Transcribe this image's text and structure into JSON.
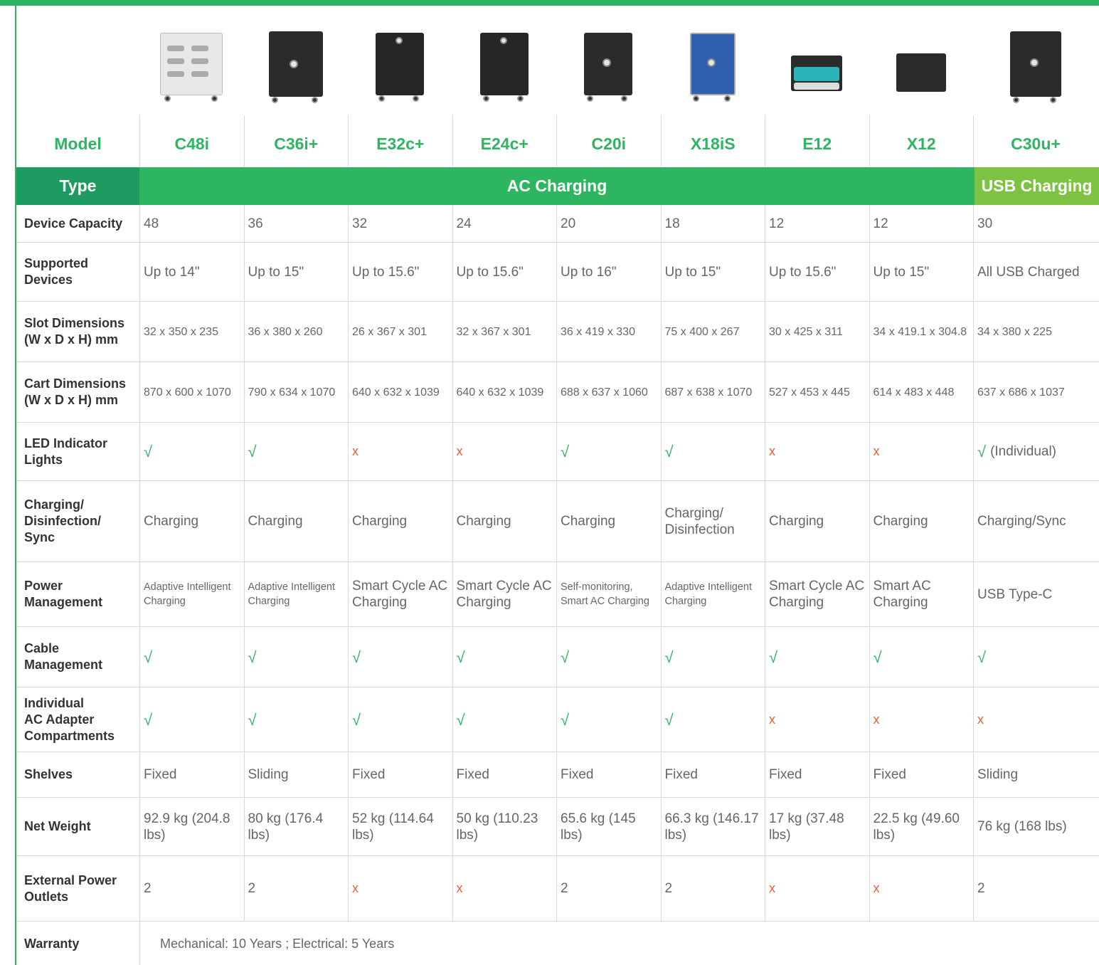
{
  "model_label": "Model",
  "type_label": "Type",
  "type_ac": "AC Charging",
  "type_usb": "USB Charging",
  "models": [
    "C48i",
    "C36i+",
    "E32c+",
    "E24c+",
    "C20i",
    "X18iS",
    "E12",
    "X12",
    "C30u+"
  ],
  "rows": [
    {
      "label": [
        "Device Capacity"
      ],
      "size": "",
      "values": [
        "48",
        "36",
        "32",
        "24",
        "20",
        "18",
        "12",
        "12",
        "30"
      ],
      "height": 53
    },
    {
      "label": [
        "Supported",
        "Devices"
      ],
      "size": "",
      "values": [
        "Up to 14\"",
        "Up to 15\"",
        "Up to 15.6\"",
        "Up to 15.6\"",
        "Up to 16\"",
        "Up to 15\"",
        "Up to 15.6\"",
        "Up to 15\"",
        "All USB Charged"
      ],
      "height": 83
    },
    {
      "label": [
        "Slot Dimensions",
        "(W x D x H) mm"
      ],
      "size": "sm",
      "values": [
        "32 x 350 x 235",
        "36 x 380 x 260",
        "26 x 367 x 301",
        "32 x 367 x 301",
        "36 x 419 x 330",
        "75 x 400 x 267",
        "30 x 425 x 311",
        "34 x 419.1 x 304.8",
        "34 x 380 x 225"
      ],
      "height": 85
    },
    {
      "label": [
        "Cart Dimensions",
        "(W x D x H) mm"
      ],
      "size": "sm",
      "values": [
        "870 x 600 x 1070",
        "790 x 634 x 1070",
        "640 x 632 x 1039",
        "640 x 632 x 1039",
        "688 x 637 x 1060",
        "687 x 638 x 1070",
        "527 x 453 x 445",
        "614 x 483 x 448",
        "637 x 686 x 1037"
      ],
      "height": 85
    },
    {
      "label": [
        "LED Indicator",
        "Lights"
      ],
      "size": "",
      "values": [
        "√",
        "√",
        "x",
        "x",
        "√",
        "√",
        "x",
        "x",
        "√"
      ],
      "extra_last": "(Individual)",
      "height": 82
    },
    {
      "label": [
        "Charging/",
        "Disinfection/",
        "Sync"
      ],
      "size": "",
      "values": [
        "Charging",
        "Charging",
        "Charging",
        "Charging",
        "Charging",
        "Charging/ Disinfection",
        "Charging",
        "Charging",
        "Charging/Sync"
      ],
      "height": 114
    },
    {
      "label": [
        "Power",
        "Management"
      ],
      "size": "mixed",
      "values": [
        "Adaptive Intelligent Charging",
        "Adaptive Intelligent Charging",
        "Smart Cycle AC Charging",
        "Smart Cycle AC Charging",
        "Self-monitoring, Smart AC Charging",
        "Adaptive Intelligent Charging",
        "Smart Cycle AC Charging",
        "Smart AC Charging",
        "USB Type-C"
      ],
      "height": 91
    },
    {
      "label": [
        "Cable",
        "Management"
      ],
      "size": "",
      "values": [
        "√",
        "√",
        "√",
        "√",
        "√",
        "√",
        "√",
        "√",
        "√"
      ],
      "height": 85
    },
    {
      "label": [
        "Individual",
        "AC Adapter",
        "Compartments"
      ],
      "size": "",
      "values": [
        "√",
        "√",
        "√",
        "√",
        "√",
        "√",
        "x",
        "x",
        "x"
      ],
      "height": 91
    },
    {
      "label": [
        "Shelves"
      ],
      "size": "",
      "values": [
        "Fixed",
        "Sliding",
        "Fixed",
        "Fixed",
        "Fixed",
        "Fixed",
        "Fixed",
        "Fixed",
        "Sliding"
      ],
      "height": 64
    },
    {
      "label": [
        "Net Weight"
      ],
      "size": "",
      "values": [
        "92.9 kg (204.8 lbs)",
        "80 kg (176.4 lbs)",
        "52 kg (114.64 lbs)",
        "50 kg (110.23 lbs)",
        "65.6 kg (145 lbs)",
        "66.3 kg (146.17 lbs)",
        "17 kg (37.48 lbs)",
        "22.5 kg (49.60 lbs)",
        "76 kg (168 lbs)"
      ],
      "height": 82
    },
    {
      "label": [
        "External Power",
        "Outlets"
      ],
      "size": "",
      "values": [
        "2",
        "2",
        "x",
        "x",
        "2",
        "2",
        "x",
        "x",
        "2"
      ],
      "height": 92
    }
  ],
  "warranty": {
    "label": "Warranty",
    "value": "Mechanical: 10 Years ; Electrical: 5 Years"
  },
  "colors": {
    "green": "#2db562",
    "dark_green": "#1e9b61",
    "light_green": "#7dc242",
    "cross": "#e8603c"
  }
}
